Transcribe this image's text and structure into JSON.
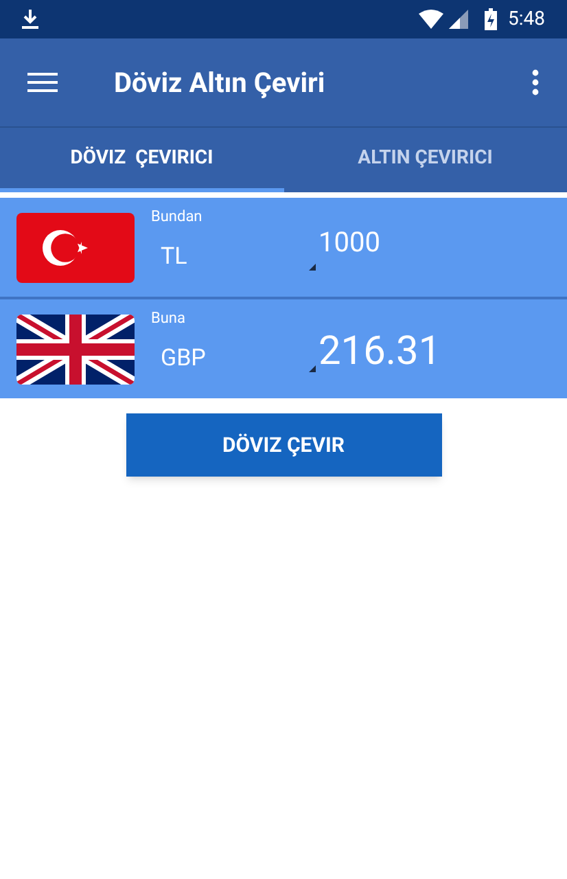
{
  "status_bar": {
    "time": "5:48"
  },
  "app_bar": {
    "title": "Döviz Altın Çeviri"
  },
  "tabs": [
    {
      "label": "DÖVIZ  ÇEVIRICI",
      "selected": true
    },
    {
      "label": "ALTIN ÇEVIRICI",
      "selected": false
    }
  ],
  "rows": [
    {
      "kind": "tr",
      "label": "Bundan",
      "currency": "TL",
      "amount": "1000"
    },
    {
      "kind": "gb",
      "label": "Buna",
      "currency": "GBP",
      "amount": "216.31"
    }
  ],
  "convert_button": "DÖVIZ ÇEVIR"
}
